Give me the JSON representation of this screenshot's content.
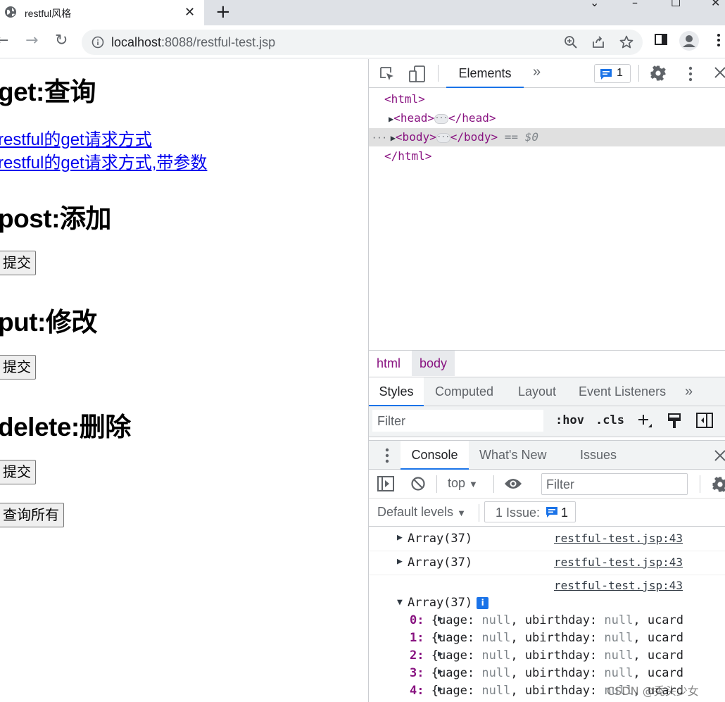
{
  "browser": {
    "tab": {
      "title": "restful风格",
      "close_glyph": "✕"
    },
    "new_tab_glyph": "+",
    "window_controls": {
      "dropdown": "⌄",
      "minimize": "–",
      "maximize": "☐",
      "close": "✕"
    },
    "nav": {
      "back": "←",
      "forward": "→",
      "reload": "↻"
    },
    "url": {
      "host": "localhost",
      "rest": ":8088/restful-test.jsp"
    }
  },
  "page": {
    "sections": [
      {
        "heading": "get:查询"
      },
      {
        "heading": "post:添加"
      },
      {
        "heading": "put:修改"
      },
      {
        "heading": "delete:删除"
      }
    ],
    "links": [
      "restful的get请求方式",
      "restful的get请求方式,带参数"
    ],
    "buttons": {
      "post_submit": "提交",
      "put_submit": "提交",
      "delete_submit": "提交",
      "query_all": "查询所有"
    }
  },
  "devtools": {
    "top_tabs": {
      "elements": "Elements",
      "more": "»"
    },
    "issues_count": "1",
    "dom_tree": {
      "html_open": "<html>",
      "head": "<head>",
      "head_close": "</head>",
      "body": "<body>",
      "body_close": "</body>",
      "eq": "== $0",
      "html_close": "</html>",
      "ellipsis": "···",
      "dots": "···"
    },
    "breadcrumbs": [
      "html",
      "body"
    ],
    "styles_tabs": [
      "Styles",
      "Computed",
      "Layout",
      "Event Listeners",
      "»"
    ],
    "styles_filter": {
      "placeholder": "Filter",
      "hov": ":hov",
      "cls": ".cls"
    },
    "drawer_tabs": [
      "Console",
      "What's New",
      "Issues"
    ],
    "console": {
      "context": "top",
      "filter_placeholder": "Filter",
      "levels": "Default levels",
      "issue_label": "1 Issue:",
      "issue_count": "1",
      "logs": [
        {
          "msg": "Array(37)",
          "src": "restful-test.jsp:43"
        },
        {
          "msg": "Array(37)",
          "src": "restful-test.jsp:43"
        },
        {
          "msg": "Array(37)",
          "src": "restful-test.jsp:43"
        }
      ],
      "items": [
        {
          "key": "0:",
          "text": "{uage: ",
          "null1": "null",
          "mid": ", ubirthday: ",
          "null2": "null",
          "tail": ", ucard"
        },
        {
          "key": "1:",
          "text": "{uage: ",
          "null1": "null",
          "mid": ", ubirthday: ",
          "null2": "null",
          "tail": ", ucard"
        },
        {
          "key": "2:",
          "text": "{uage: ",
          "null1": "null",
          "mid": ", ubirthday: ",
          "null2": "null",
          "tail": ", ucard"
        },
        {
          "key": "3:",
          "text": "{uage: ",
          "null1": "null",
          "mid": ", ubirthday: ",
          "null2": "null",
          "tail": ", ucard"
        },
        {
          "key": "4:",
          "text": "{uage: ",
          "null1": "null",
          "mid": ", ubirthday: ",
          "null2": "null",
          "tail": ", ucard"
        }
      ]
    }
  },
  "watermark": "CSDN @秃头少女",
  "colors": {
    "link": "#0000ee",
    "accent": "#1a73e8",
    "tag": "#881280"
  }
}
